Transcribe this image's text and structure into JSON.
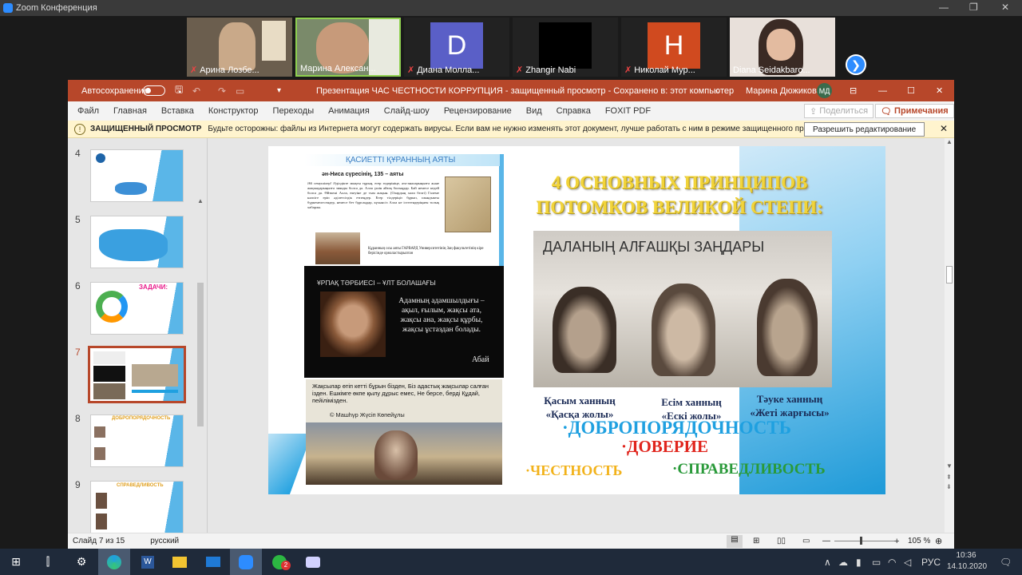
{
  "zoom": {
    "title": "Zoom Конференция",
    "participants": [
      {
        "name": "Арина Лозбе...",
        "letter": "",
        "color": "#7a6a55"
      },
      {
        "name": "Марина Алексан...",
        "letter": "",
        "color": "#7a8a6a"
      },
      {
        "name": "Диана Молла...",
        "letter": "D",
        "color": "#5a5fc7"
      },
      {
        "name": "Zhangir Nabi",
        "letter": "",
        "color": "#000000"
      },
      {
        "name": "Николай Мур...",
        "letter": "H",
        "color": "#d04a1f"
      },
      {
        "name": "Diana Seidakbaro...",
        "letter": "",
        "color": "#e8e0da"
      }
    ]
  },
  "ppt": {
    "autosave": "Автосохранение",
    "title": "Презентация  ЧАС ЧЕСТНОСТИ КОРРУПЦИЯ  -  защищенный просмотр  -  Сохранено в: этот компьютер",
    "user": "Марина Дюжикова",
    "user_initials": "МД",
    "menu": [
      "Файл",
      "Главная",
      "Вставка",
      "Конструктор",
      "Переходы",
      "Анимация",
      "Слайд-шоу",
      "Рецензирование",
      "Вид",
      "Справка",
      "FOXIT PDF"
    ],
    "share": "Поделиться",
    "comments": "Примечания",
    "protected_label": "ЗАЩИЩЕННЫЙ ПРОСМОТР",
    "protected_text": "Будьте осторожны: файлы из Интернета могут содержать вирусы. Если вам не нужно изменять этот документ, лучше работать с ним в режиме защищенного просмотра.",
    "enable_edit": "Разрешить редактирование",
    "slide_numbers": [
      "4",
      "5",
      "6",
      "7",
      "8",
      "9"
    ],
    "status_slide": "Слайд 7 из 15",
    "status_lang": "русский",
    "zoom_level": "105 %"
  },
  "slide": {
    "top_left_title": "ҚАСИЕТТІ ҚҰРАННЫҢ АЯТЫ",
    "verse_ref": "ән-Ниса сүресінің, 135 – аяты",
    "verse_text": "Әй семушілер! Әділдікте мықты тұрың, егер өздерініңе, ата-аналарыңызға және жақындарыңызға зиянды болса да. Алла үшін айғақ болыңдар. Бай немесе кедей болса да. Өйткені Алла, екеуіне де тым жақын. (Олардың хали белгі) Галеме нәпсіге еріп әділетсіздік етпеңдер. Егер тілдеріңіз бұрып, шындыкты бүркемелесендер, немесе бет бұрсаңдар, күмәнсіз Алла не істегендеріңнен толық хабарлы.",
    "harvard_text": "Құранның осы аяты ГАРВАРД Университетінің Заң факультетінің кіре берісінде орналастырылған",
    "abai_header": "ҰРПАҚ ТӘРБИЕСІ – ҰЛТ БОЛАШАҒЫ",
    "abai_quote": "Адамның адамшылдығы – ақыл, ғылым, жақсы ата, жақсы ана, жақсы құрбы, жақсы ұстаздан болады.",
    "abai_author": "Абай",
    "mashhur_quote": "Жақсылар өтіп кетті бұрын бізден, Біз адастық жақсылар салған ізден. Ешкімге өкпе қылу дұрыс емес, Не берсе, берді Құдай, пейілімізден.",
    "mashhur_author": "© Машһүр Жүсіп Көпейұлы",
    "main_title_1": "4 ОСНОВНЫХ ПРИНЦИПОВ",
    "main_title_2": "ПОТОМКОВ ВЕЛИКОЙ СТЕПИ:",
    "photo_title": "ДАЛАНЫҢ АЛҒАШҚЫ ЗАҢДАРЫ",
    "khan1_a": "Қасым ханның",
    "khan1_b": "«Қасқа жолы»",
    "khan2_a": "Есім ханның",
    "khan2_b": "«Ескі жолы»",
    "khan3_a": "Тәуке ханның",
    "khan3_b": "«Жеті жарғысы»",
    "principle1": "ДОБРОПОРЯДОЧНОСТЬ",
    "principle2": "ДОВЕРИЕ",
    "principle3": "ЧЕСТНОСТЬ",
    "principle4": "СПРАВЕДЛИВОСТЬ"
  },
  "thumb_texts": {
    "t6": "ЗАДАЧИ:",
    "t8": "ДОБРОПОРЯДОЧНОСТЬ",
    "t9": "СПРАВЕДЛИВОСТЬ"
  },
  "taskbar": {
    "lang": "РУС",
    "time": "10:36",
    "date": "14.10.2020",
    "whatsapp_badge": "2"
  },
  "colors": {
    "accent": "#b7472a",
    "zoom_blue": "#2d8cff",
    "title_yellow": "#f2d43a",
    "principle_blue": "#1fa0e0",
    "principle_red": "#e0241c",
    "principle_orange": "#f2b21a",
    "principle_green": "#2a9a3a"
  }
}
